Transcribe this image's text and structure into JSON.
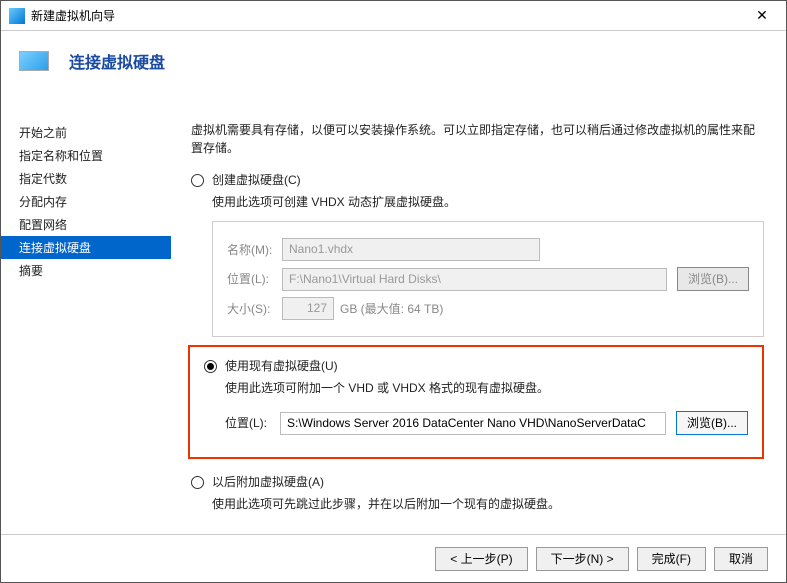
{
  "titlebar": {
    "text": "新建虚拟机向导"
  },
  "header": {
    "title": "连接虚拟硬盘"
  },
  "sidebar": {
    "items": [
      {
        "label": "开始之前"
      },
      {
        "label": "指定名称和位置"
      },
      {
        "label": "指定代数"
      },
      {
        "label": "分配内存"
      },
      {
        "label": "配置网络"
      },
      {
        "label": "连接虚拟硬盘"
      },
      {
        "label": "摘要"
      }
    ]
  },
  "main": {
    "desc": "虚拟机需要具有存储，以便可以安装操作系统。可以立即指定存储，也可以稍后通过修改虚拟机的属性来配置存储。",
    "opt1": {
      "label": "创建虚拟硬盘(C)",
      "desc": "使用此选项可创建 VHDX 动态扩展虚拟硬盘。",
      "name_label": "名称(M):",
      "name_value": "Nano1.vhdx",
      "loc_label": "位置(L):",
      "loc_value": "F:\\Nano1\\Virtual Hard Disks\\",
      "browse": "浏览(B)...",
      "size_label": "大小(S):",
      "size_value": "127",
      "size_unit": "GB (最大值: 64 TB)"
    },
    "opt2": {
      "label": "使用现有虚拟硬盘(U)",
      "desc": "使用此选项可附加一个 VHD 或 VHDX 格式的现有虚拟硬盘。",
      "loc_label": "位置(L):",
      "loc_value": "S:\\Windows Server 2016 DataCenter Nano VHD\\NanoServerDataC",
      "browse": "浏览(B)..."
    },
    "opt3": {
      "label": "以后附加虚拟硬盘(A)",
      "desc": "使用此选项可先跳过此步骤，并在以后附加一个现有的虚拟硬盘。"
    }
  },
  "footer": {
    "prev": "< 上一步(P)",
    "next": "下一步(N) >",
    "finish": "完成(F)",
    "cancel": "取消"
  }
}
